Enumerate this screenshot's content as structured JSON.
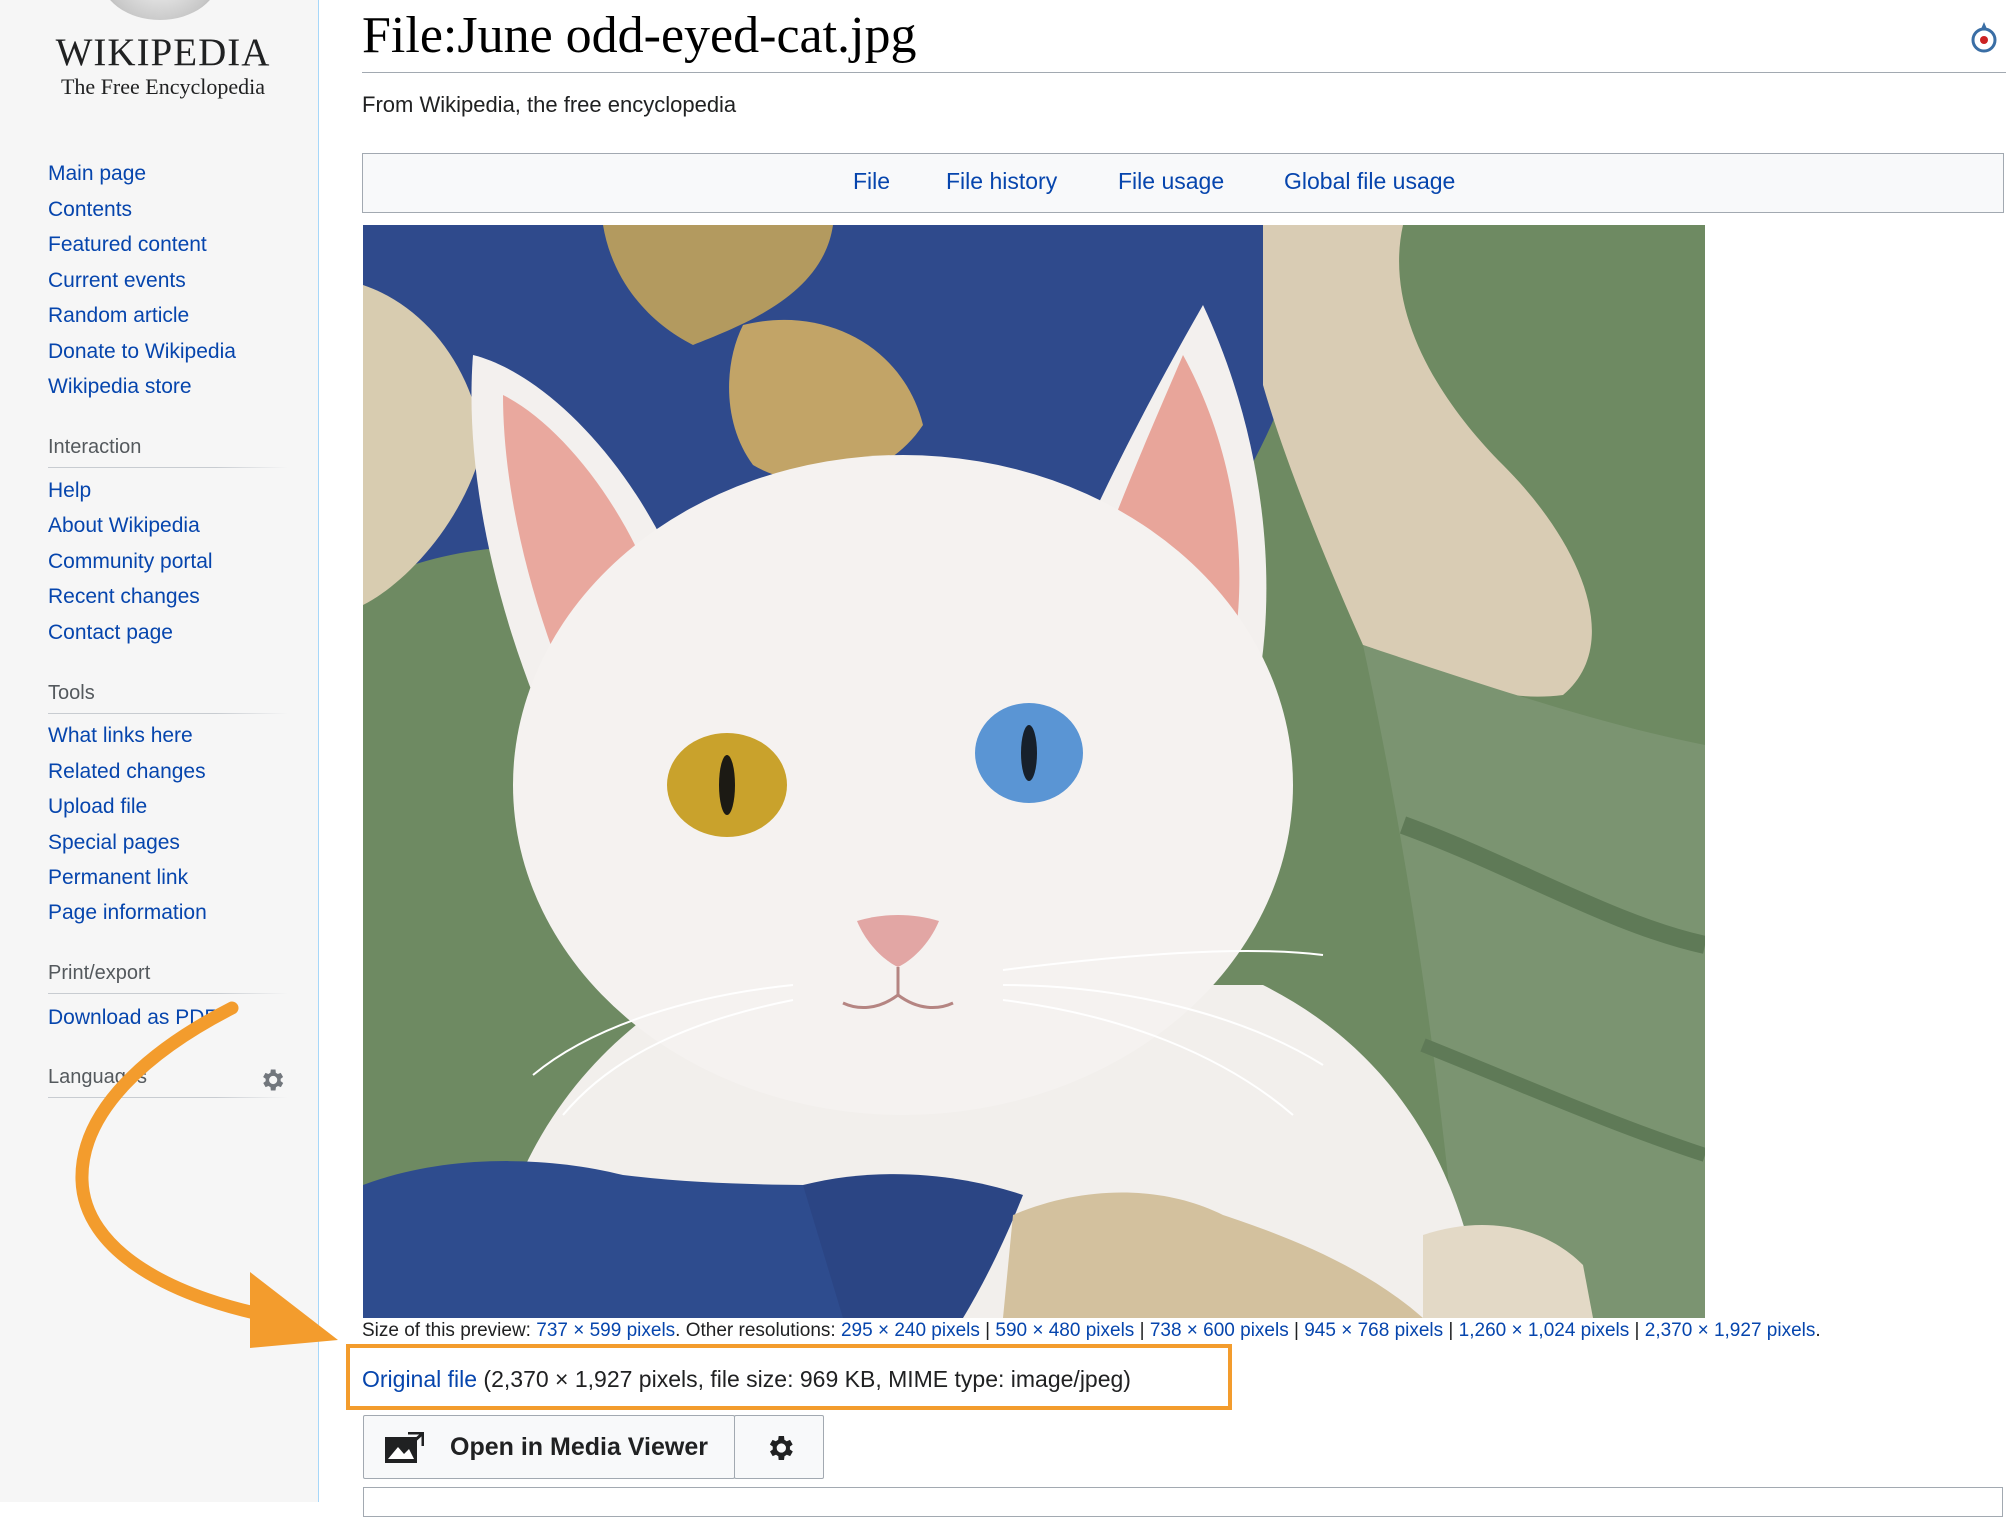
{
  "logo": {
    "wordmark": "WIKIPEDIA",
    "tagline": "The Free Encyclopedia"
  },
  "sidebar": {
    "navigation": [
      "Main page",
      "Contents",
      "Featured content",
      "Current events",
      "Random article",
      "Donate to Wikipedia",
      "Wikipedia store"
    ],
    "interaction": {
      "heading": "Interaction",
      "items": [
        "Help",
        "About Wikipedia",
        "Community portal",
        "Recent changes",
        "Contact page"
      ]
    },
    "tools": {
      "heading": "Tools",
      "items": [
        "What links here",
        "Related changes",
        "Upload file",
        "Special pages",
        "Permanent link",
        "Page information"
      ]
    },
    "print_export": {
      "heading": "Print/export",
      "items": [
        "Download as PDF"
      ]
    },
    "languages": {
      "heading": "Languages",
      "icon": "gear-icon"
    }
  },
  "page": {
    "title": "File:June odd-eyed-cat.jpg",
    "subtitle": "From Wikipedia, the free encyclopedia",
    "commons_icon": "commons-logo-icon"
  },
  "file_toc": [
    "File",
    "File history",
    "File usage",
    "Global file usage"
  ],
  "preview": {
    "size_prefix": "Size of this preview: ",
    "size": "737 × 599 pixels",
    "other_prefix": ". Other resolutions: ",
    "resolutions": [
      "295 × 240 pixels",
      "590 × 480 pixels",
      "738 × 600 pixels",
      "945 × 768 pixels",
      "1,260 × 1,024 pixels",
      "2,370 × 1,927 pixels"
    ],
    "separator": " | ",
    "suffix": "."
  },
  "original_file": {
    "link": "Original file",
    "details": " (2,370 × 1,927 pixels, file size: 969 KB, MIME type: image/jpeg)"
  },
  "media_viewer": {
    "label": "Open in Media Viewer",
    "icon": "image-expand-icon",
    "settings_icon": "gear-icon"
  },
  "colors": {
    "link": "#0645ad",
    "highlight": "#f39c2d",
    "sidebar_bg": "#f6f6f6"
  }
}
